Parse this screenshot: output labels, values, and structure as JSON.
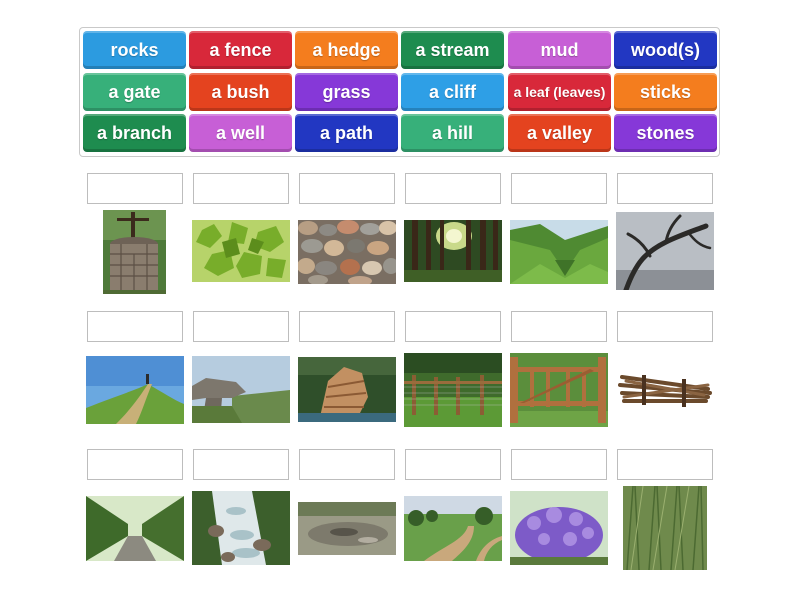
{
  "word_bank": {
    "tiles": [
      {
        "label": "rocks",
        "color": "#2c9be0"
      },
      {
        "label": "a fence",
        "color": "#d8283a"
      },
      {
        "label": "a hedge",
        "color": "#f47d1e"
      },
      {
        "label": "a stream",
        "color": "#1e8c4f"
      },
      {
        "label": "mud",
        "color": "#c75fd6"
      },
      {
        "label": "wood(s)",
        "color": "#2237c2"
      },
      {
        "label": "a gate",
        "color": "#37b07a"
      },
      {
        "label": "a bush",
        "color": "#e4431f"
      },
      {
        "label": "grass",
        "color": "#8638d8"
      },
      {
        "label": "a cliff",
        "color": "#2e9fe6"
      },
      {
        "label": "a leaf (leaves)",
        "color": "#d8283a"
      },
      {
        "label": "sticks",
        "color": "#f47d1e"
      },
      {
        "label": "a branch",
        "color": "#1e8c4f"
      },
      {
        "label": "a well",
        "color": "#c75fd6"
      },
      {
        "label": "a path",
        "color": "#2237c2"
      },
      {
        "label": "a hill",
        "color": "#37b07a"
      },
      {
        "label": "a valley",
        "color": "#e4431f"
      },
      {
        "label": "stones",
        "color": "#8638d8"
      }
    ]
  },
  "answer_slots": {
    "count": 18,
    "values": [
      "",
      "",
      "",
      "",
      "",
      "",
      "",
      "",
      "",
      "",
      "",
      "",
      "",
      "",
      "",
      "",
      "",
      ""
    ]
  },
  "images": [
    "stone-well-photo",
    "maple-leaves-photo",
    "pebble-stones-photo",
    "forest-woods-photo",
    "green-valley-photo",
    "bare-branch-photo",
    "grassy-hill-photo",
    "rock-cliff-photo",
    "rocky-cliff-photo",
    "wooden-fence-photo",
    "wooden-gate-photo",
    "bundle-of-sticks-photo",
    "hedge-path-photo",
    "forest-stream-photo",
    "mud-puddle-photo",
    "dirt-path-photo",
    "lavender-bush-photo",
    "grass-closeup-photo"
  ]
}
